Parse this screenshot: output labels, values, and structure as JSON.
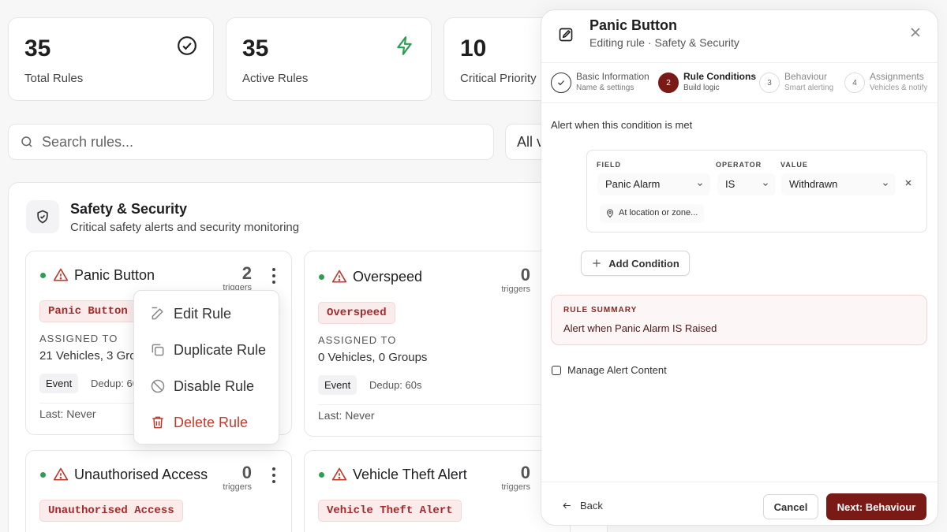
{
  "stats": [
    {
      "value": "35",
      "label": "Total Rules",
      "icon": "check-circle-icon"
    },
    {
      "value": "35",
      "label": "Active Rules",
      "icon": "lightning-icon"
    },
    {
      "value": "10",
      "label": "Critical Priority",
      "icon": ""
    }
  ],
  "search": {
    "placeholder": "Search rules...",
    "filter_label": "All v"
  },
  "group": {
    "title": "Safety & Security",
    "subtitle": "Critical safety alerts and security monitoring"
  },
  "rules": [
    {
      "name": "Panic Button",
      "triggers": "2",
      "triggers_label": "triggers",
      "code": "Panic Button",
      "assigned_label": "ASSIGNED TO",
      "assigned": "21 Vehicles, 3 Groups",
      "type": "Event",
      "dedup": "Dedup: 60s",
      "last": "Last: Never"
    },
    {
      "name": "Overspeed",
      "triggers": "0",
      "triggers_label": "triggers",
      "code": "Overspeed",
      "assigned_label": "ASSIGNED TO",
      "assigned": "0 Vehicles, 0 Groups",
      "type": "Event",
      "dedup": "Dedup: 60s",
      "last": "Last: Never"
    },
    {
      "name": "Unauthorised Access",
      "triggers": "0",
      "triggers_label": "triggers",
      "code": "Unauthorised Access"
    },
    {
      "name": "Vehicle Theft Alert",
      "triggers": "0",
      "triggers_label": "triggers",
      "code": "Vehicle Theft Alert"
    }
  ],
  "context_menu": [
    "Edit Rule",
    "Duplicate Rule",
    "Disable Rule",
    "Delete Rule"
  ],
  "panel": {
    "title": "Panic Button",
    "subtitle": "Editing rule · Safety & Security",
    "steps": [
      {
        "num": "",
        "title": "Basic Information",
        "sub": "Name & settings"
      },
      {
        "num": "2",
        "title": "Rule Conditions",
        "sub": "Build logic"
      },
      {
        "num": "3",
        "title": "Behaviour",
        "sub": "Smart alerting"
      },
      {
        "num": "4",
        "title": "Assignments",
        "sub": "Vehicles & notify"
      }
    ],
    "condition_label": "Alert when this condition is met",
    "field_header": "FIELD",
    "operator_header": "OPERATOR",
    "value_header": "VALUE",
    "field_value": "Panic Alarm",
    "operator_value": "IS",
    "value_value": "Withdrawn",
    "location_placeholder": "At location or zone...",
    "add_condition": "Add Condition",
    "summary_header": "RULE SUMMARY",
    "summary_text": "Alert when Panic Alarm IS Raised",
    "manage_label": "Manage Alert Content",
    "back": "Back",
    "cancel": "Cancel",
    "next": "Next: Behaviour"
  },
  "colors": {
    "accent": "#7a1a16",
    "active_dot": "#2f9e55",
    "danger": "#c0392b",
    "code_bg": "#fbecec"
  }
}
